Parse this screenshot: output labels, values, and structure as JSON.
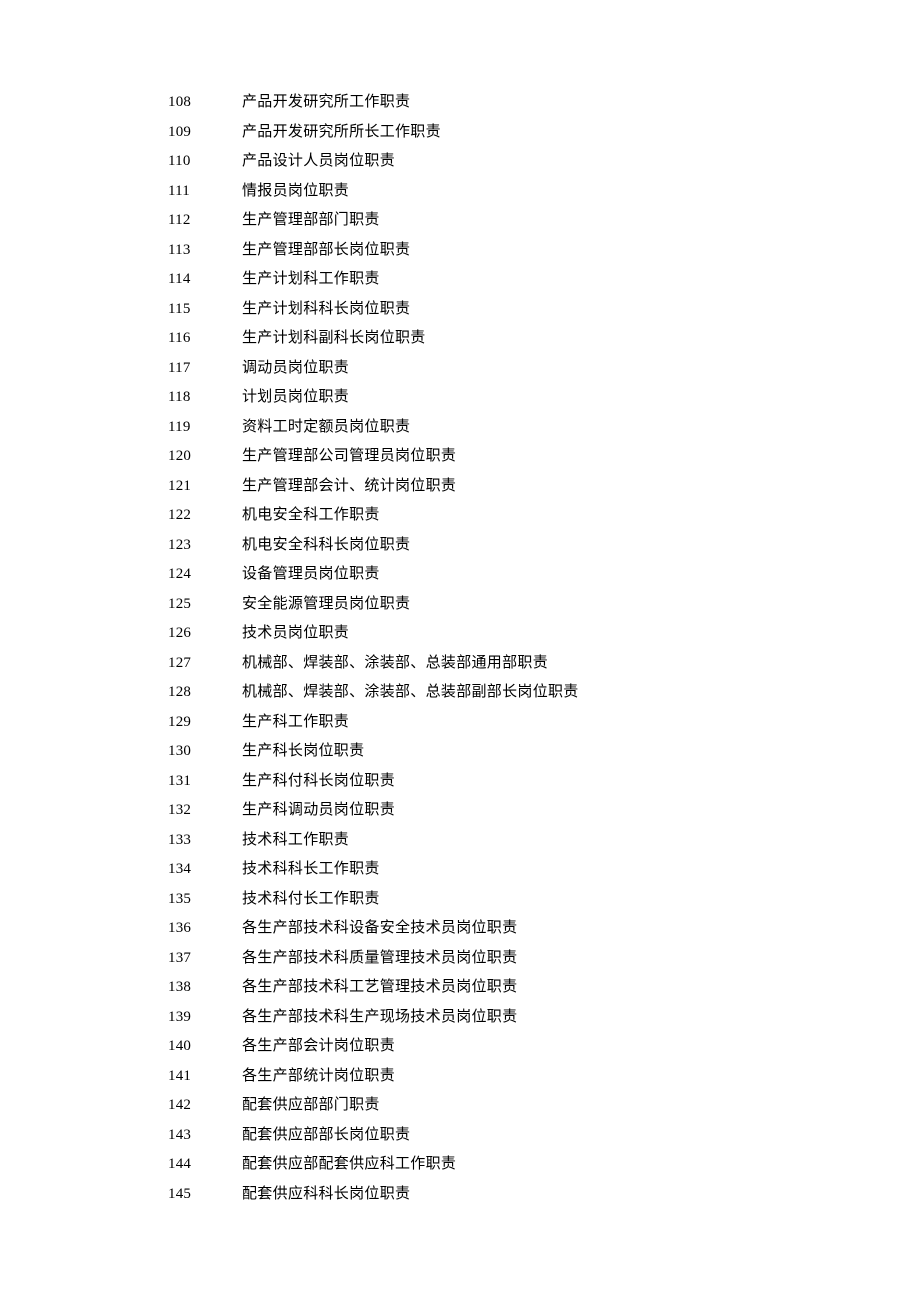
{
  "toc": [
    {
      "num": "108",
      "title": "产品开发研究所工作职责"
    },
    {
      "num": "109",
      "title": "产品开发研究所所长工作职责"
    },
    {
      "num": "110",
      "title": "产品设计人员岗位职责"
    },
    {
      "num": "111",
      "title": "情报员岗位职责"
    },
    {
      "num": "112",
      "title": "生产管理部部门职责"
    },
    {
      "num": "113",
      "title": "生产管理部部长岗位职责"
    },
    {
      "num": "114",
      "title": "生产计划科工作职责"
    },
    {
      "num": "115",
      "title": "生产计划科科长岗位职责"
    },
    {
      "num": "116",
      "title": "生产计划科副科长岗位职责"
    },
    {
      "num": "117",
      "title": "调动员岗位职责"
    },
    {
      "num": "118",
      "title": "计划员岗位职责"
    },
    {
      "num": "119",
      "title": "资料工时定额员岗位职责"
    },
    {
      "num": "120",
      "title": "生产管理部公司管理员岗位职责"
    },
    {
      "num": "121",
      "title": "生产管理部会计、统计岗位职责"
    },
    {
      "num": "122",
      "title": "机电安全科工作职责"
    },
    {
      "num": "123",
      "title": "机电安全科科长岗位职责"
    },
    {
      "num": "124",
      "title": "设备管理员岗位职责"
    },
    {
      "num": "125",
      "title": "安全能源管理员岗位职责"
    },
    {
      "num": "126",
      "title": "技术员岗位职责"
    },
    {
      "num": "127",
      "title": "机械部、焊装部、涂装部、总装部通用部职责"
    },
    {
      "num": "128",
      "title": "机械部、焊装部、涂装部、总装部副部长岗位职责"
    },
    {
      "num": "129",
      "title": "生产科工作职责"
    },
    {
      "num": "130",
      "title": "生产科长岗位职责"
    },
    {
      "num": "131",
      "title": "生产科付科长岗位职责"
    },
    {
      "num": "132",
      "title": "生产科调动员岗位职责"
    },
    {
      "num": "133",
      "title": "技术科工作职责"
    },
    {
      "num": "134",
      "title": "技术科科长工作职责"
    },
    {
      "num": "135",
      "title": "技术科付长工作职责"
    },
    {
      "num": "136",
      "title": "各生产部技术科设备安全技术员岗位职责"
    },
    {
      "num": "137",
      "title": "各生产部技术科质量管理技术员岗位职责"
    },
    {
      "num": "138",
      "title": "各生产部技术科工艺管理技术员岗位职责"
    },
    {
      "num": "139",
      "title": "各生产部技术科生产现场技术员岗位职责"
    },
    {
      "num": "140",
      "title": "各生产部会计岗位职责"
    },
    {
      "num": "141",
      "title": "各生产部统计岗位职责"
    },
    {
      "num": "142",
      "title": "配套供应部部门职责"
    },
    {
      "num": "143",
      "title": "配套供应部部长岗位职责"
    },
    {
      "num": "144",
      "title": "配套供应部配套供应科工作职责"
    },
    {
      "num": "145",
      "title": "配套供应科科长岗位职责"
    }
  ]
}
